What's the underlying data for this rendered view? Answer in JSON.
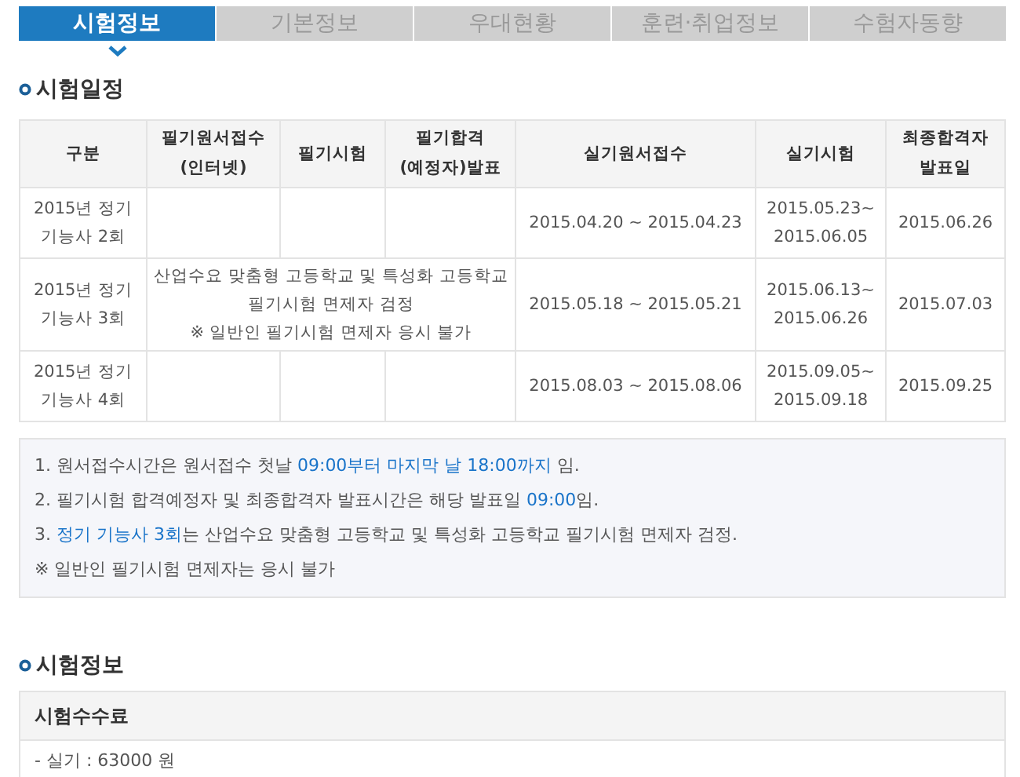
{
  "tabs": [
    {
      "label": "시험정보",
      "selected": true
    },
    {
      "label": "기본정보",
      "selected": false
    },
    {
      "label": "우대현황",
      "selected": false
    },
    {
      "label": "훈련·취업정보",
      "selected": false
    },
    {
      "label": "수험자동향",
      "selected": false
    }
  ],
  "schedule": {
    "title": "시험일정",
    "columns": [
      "구분",
      "필기원서접수\n(인터넷)",
      "필기시험",
      "필기합격\n(예정자)발표",
      "실기원서접수",
      "실기시험",
      "최종합격자\n발표일"
    ],
    "rows": [
      {
        "round": "2015년 정기\n기능사 2회",
        "practical_apply": "2015.04.20 ~ 2015.04.23",
        "practical_exam": "2015.05.23~\n2015.06.05",
        "final_announce": "2015.06.26"
      },
      {
        "round": "2015년 정기\n기능사 3회",
        "note": "산업수요 맞춤형 고등학교 및 특성화 고등학교\n필기시험 면제자 검정\n※ 일반인 필기시험 면제자 응시 불가",
        "practical_apply": "2015.05.18 ~ 2015.05.21",
        "practical_exam": "2015.06.13~\n2015.06.26",
        "final_announce": "2015.07.03"
      },
      {
        "round": "2015년 정기\n기능사 4회",
        "practical_apply": "2015.08.03 ~ 2015.08.06",
        "practical_exam": "2015.09.05~\n2015.09.18",
        "final_announce": "2015.09.25"
      }
    ],
    "notes": [
      [
        {
          "text": "1. 원서접수시간은 원서접수 첫날 ",
          "highlight": false
        },
        {
          "text": "09:00부터 마지막 날 18:00까지",
          "highlight": true
        },
        {
          "text": " 임.",
          "highlight": false
        }
      ],
      [
        {
          "text": "2. 필기시험 합격예정자 및 최종합격자 발표시간은 해당 발표일 ",
          "highlight": false
        },
        {
          "text": "09:00",
          "highlight": true
        },
        {
          "text": "임.",
          "highlight": false
        }
      ],
      [
        {
          "text": "3. ",
          "highlight": false
        },
        {
          "text": "정기 기능사 3회",
          "highlight": true
        },
        {
          "text": "는 산업수요 맞춤형 고등학교 및 특성화 고등학교 필기시험 면제자 검정.",
          "highlight": false
        }
      ],
      [
        {
          "text": "※ 일반인 필기시험 면제자는 응시 불가",
          "highlight": false
        }
      ]
    ]
  },
  "info": {
    "title": "시험정보",
    "fee_title": "시험수수료",
    "fee_rows": [
      "- 실기 : 63000 원"
    ]
  }
}
